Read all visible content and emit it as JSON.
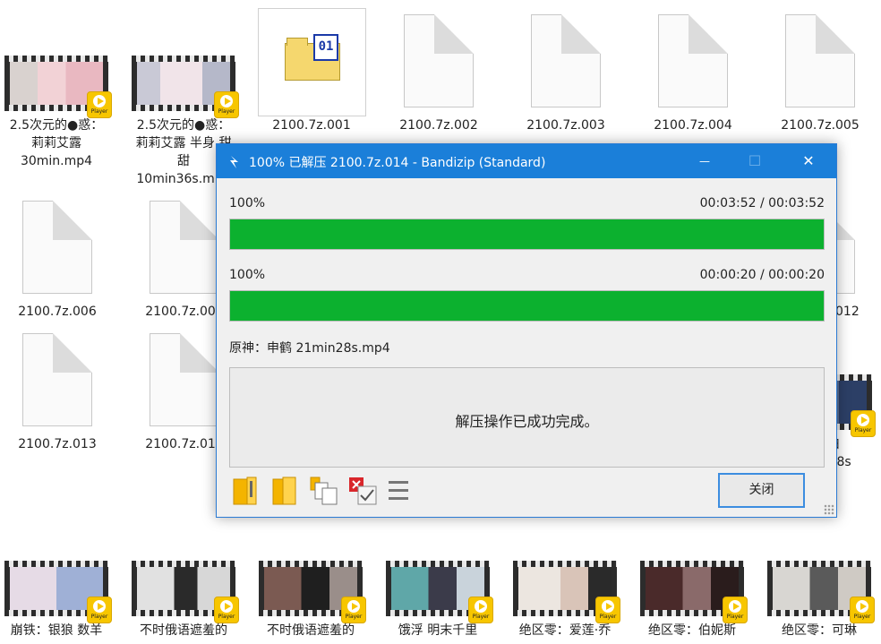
{
  "files_row1": [
    {
      "label": "2.5次元的●惑：\n莉莉艾露\n30min.mp4"
    },
    {
      "label": "2.5次元的●惑：\n莉莉艾露 半身 甜\n甜\n10min36s.mp4"
    },
    {
      "label": "2100.7z.001"
    },
    {
      "label": "2100.7z.002"
    },
    {
      "label": "2100.7z.003"
    },
    {
      "label": "2100.7z.004"
    },
    {
      "label": "2100.7z.005"
    }
  ],
  "files_row2": [
    {
      "label": "2100.7z.006"
    },
    {
      "label": "2100.7z.007"
    },
    {
      "label": "2100.7z.012"
    }
  ],
  "files_row3": [
    {
      "label": "2100.7z.013"
    },
    {
      "label": "2100.7z.014"
    },
    {
      "label": "● 表白\n21min38s"
    }
  ],
  "files_row4": [
    {
      "label": "崩铁：银狼 数羊"
    },
    {
      "label": "不时俄语遮羞的"
    },
    {
      "label": "不时俄语遮羞的"
    },
    {
      "label": "饿浮 明末千里"
    },
    {
      "label": "绝区零：爱莲·乔"
    },
    {
      "label": "绝区零：伯妮斯"
    },
    {
      "label": "绝区零：可琳"
    }
  ],
  "video_badge_text": "Player",
  "dialog": {
    "title": "100% 已解压 2100.7z.014 - Bandizip (Standard)",
    "minimize": "—",
    "maximize": "☐",
    "close": "✕",
    "total_percent": "100%",
    "total_time": "00:03:52 / 00:03:52",
    "total_progress": 1.0,
    "file_percent": "100%",
    "file_time": "00:00:20 / 00:00:20",
    "file_progress": 1.0,
    "current_file": "原神：申鹤 21min28s.mp4",
    "message": "解压操作已成功完成。",
    "close_button": "关闭",
    "accent": "#1b7fd9",
    "progress_color": "#0cb12f"
  }
}
